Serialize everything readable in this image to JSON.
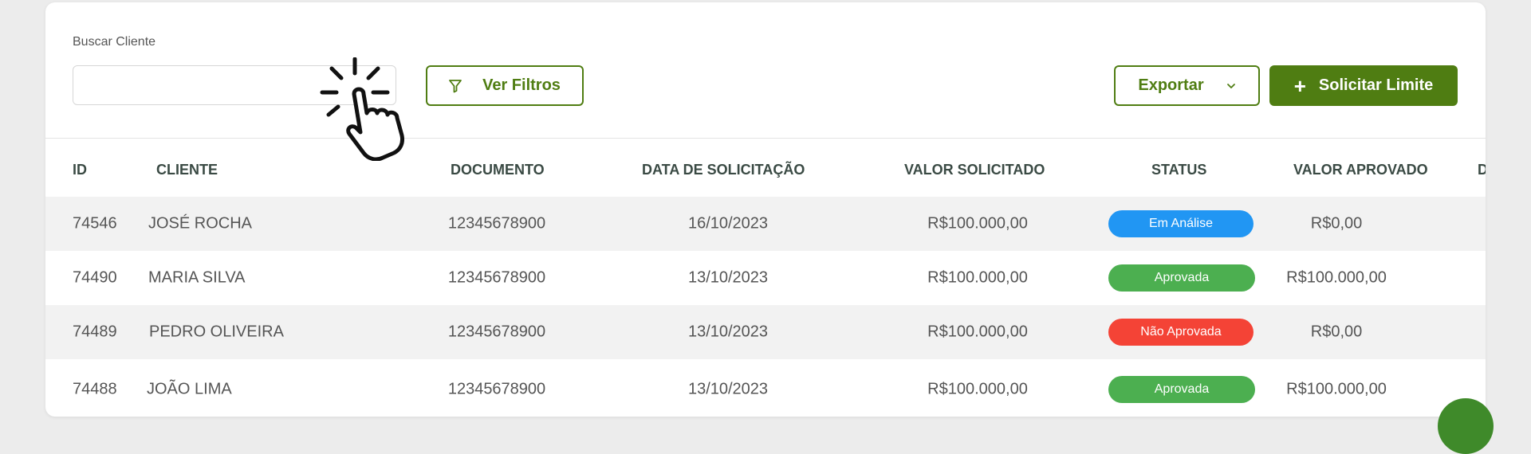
{
  "search": {
    "label": "Buscar Cliente",
    "value": "",
    "placeholder": ""
  },
  "toolbar": {
    "filter_label": "Ver Filtros",
    "filter_icon": "funnel-icon",
    "export_label": "Exportar",
    "export_icon": "chevron-down-icon",
    "request_label": "Solicitar Limite",
    "request_icon": "plus-icon",
    "request_symbol": "+"
  },
  "colors": {
    "accent": "#4f7d12",
    "status_em_analise": "#2196f3",
    "status_aprovada": "#4caf50",
    "status_nao_aprovada": "#f44336"
  },
  "table": {
    "columns": [
      "ID",
      "CLIENTE",
      "DOCUMENTO",
      "DATA DE SOLICITAÇÃO",
      "VALOR SOLICITADO",
      "STATUS",
      "VALOR APROVADO",
      "D"
    ],
    "rows": [
      {
        "id": "74546",
        "cliente": "JOSÉ ROCHA",
        "documento": "12345678900",
        "data": "16/10/2023",
        "valor_solicitado": "R$100.000,00",
        "status": "Em Análise",
        "valor_aprovado": "R$0,00"
      },
      {
        "id": "74490",
        "cliente": "MARIA SILVA",
        "documento": "12345678900",
        "data": "13/10/2023",
        "valor_solicitado": "R$100.000,00",
        "status": "Aprovada",
        "valor_aprovado": "R$100.000,00"
      },
      {
        "id": "74489",
        "cliente": "PEDRO OLIVEIRA",
        "documento": "12345678900",
        "data": "13/10/2023",
        "valor_solicitado": "R$100.000,00",
        "status": "Não Aprovada",
        "valor_aprovado": "R$0,00"
      },
      {
        "id": "74488",
        "cliente": "JOÃO LIMA",
        "documento": "12345678900",
        "data": "13/10/2023",
        "valor_solicitado": "R$100.000,00",
        "status": "Aprovada",
        "valor_aprovado": "R$100.000,00"
      }
    ]
  },
  "overlay": {
    "cursor_icon": "pointing-hand-click-icon"
  }
}
